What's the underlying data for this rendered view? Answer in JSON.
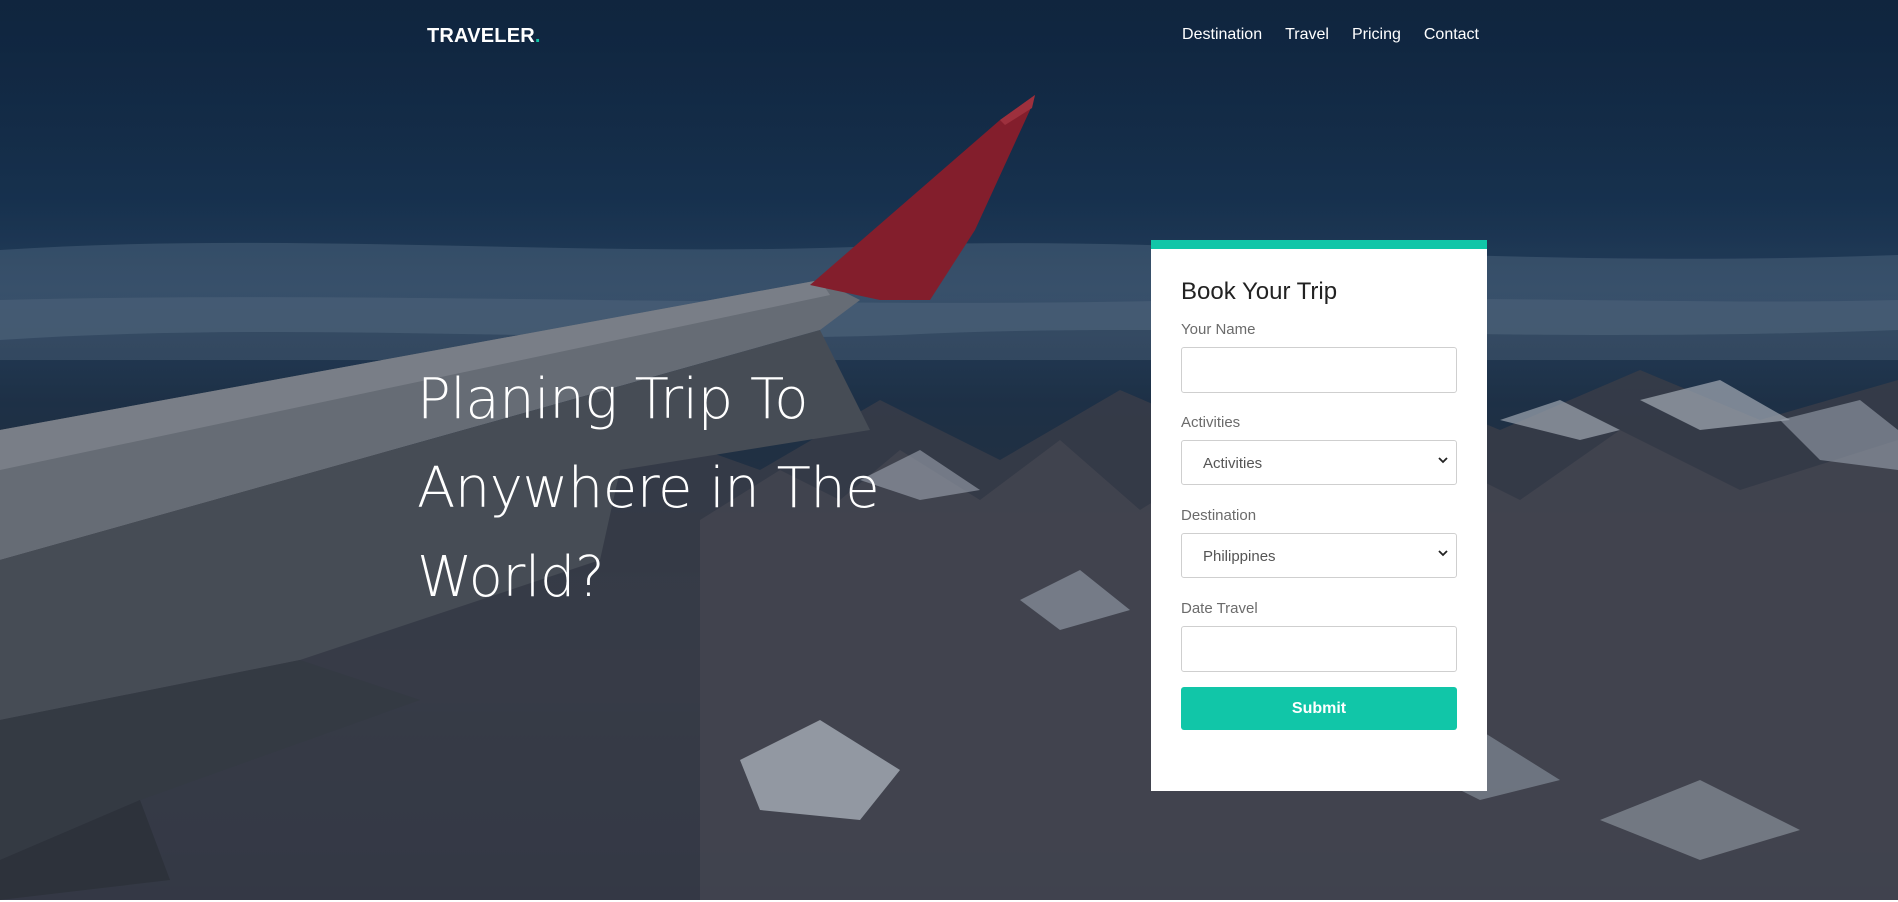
{
  "nav": {
    "brand": "TRAVELER",
    "brand_dot": ".",
    "links": [
      "Destination",
      "Travel",
      "Pricing",
      "Contact"
    ]
  },
  "hero": {
    "headline_lines": [
      "Planing Trip To",
      "Anywhere in The",
      "World?"
    ]
  },
  "booking": {
    "title": "Book Your Trip",
    "name_label": "Your Name",
    "name_value": "",
    "activities_label": "Activities",
    "activities_selected": "Activities",
    "destination_label": "Destination",
    "destination_selected": "Philippines",
    "date_label": "Date Travel",
    "date_value": "",
    "submit_label": "Submit"
  },
  "colors": {
    "accent": "#11c6a8",
    "card_bg": "#ffffff",
    "text_light": "#ffffff"
  },
  "icons": {
    "select_arrow": "chevron-down-icon"
  }
}
